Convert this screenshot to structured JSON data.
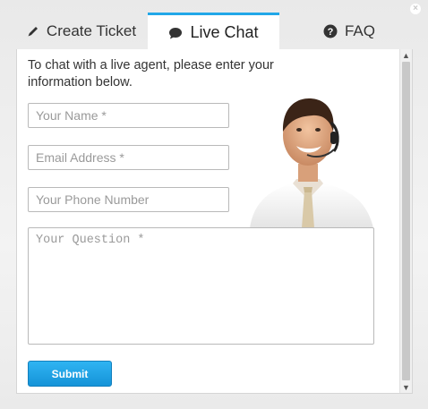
{
  "tabs": [
    {
      "label": "Create Ticket",
      "icon": "pencil-icon"
    },
    {
      "label": "Live Chat",
      "icon": "chat-bubble-icon",
      "active": true
    },
    {
      "label": "FAQ",
      "icon": "question-circle-icon"
    }
  ],
  "form": {
    "intro": "To chat with a live agent, please enter your information below.",
    "name_placeholder": "Your Name *",
    "email_placeholder": "Email Address *",
    "phone_placeholder": "Your Phone Number",
    "question_placeholder": "Your Question *",
    "submit_label": "Submit"
  },
  "colors": {
    "accent": "#22a7e8",
    "button": "#1a9be0",
    "background": "#ededed"
  }
}
